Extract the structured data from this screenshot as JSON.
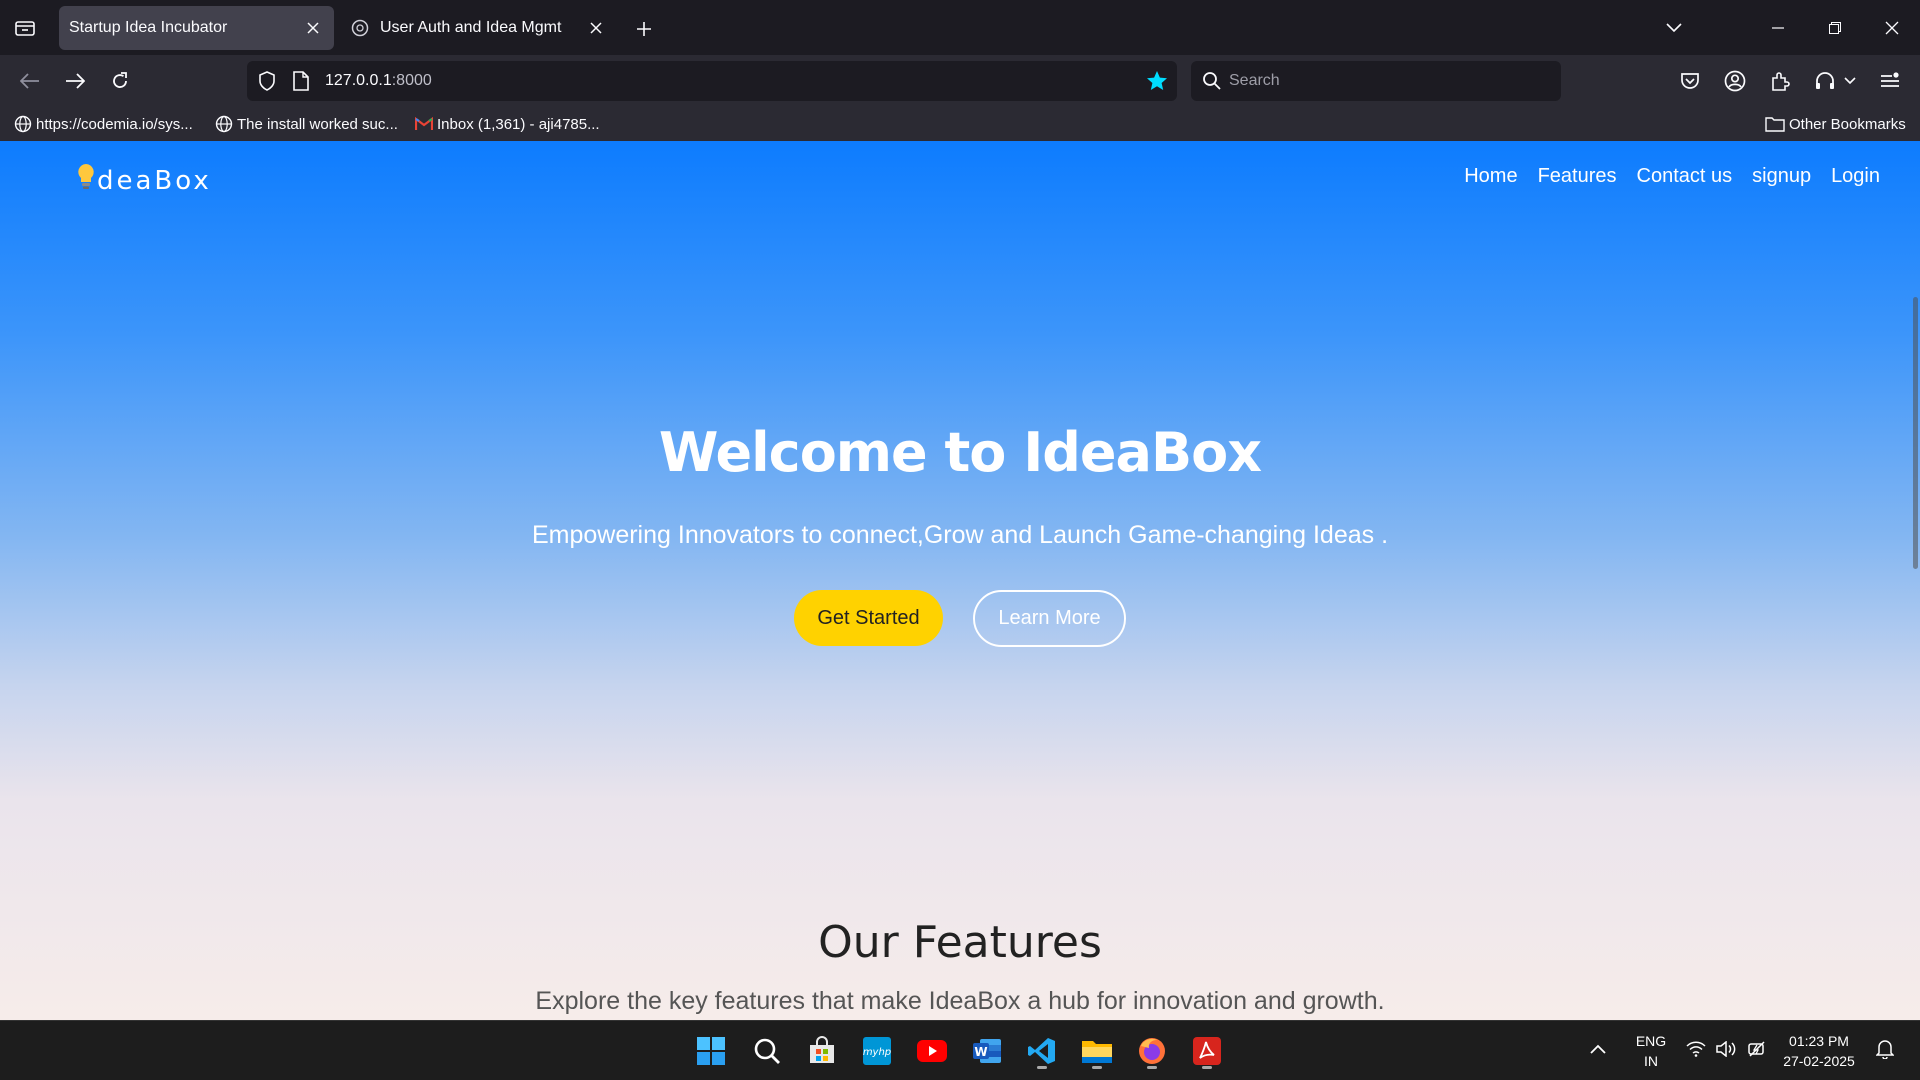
{
  "browser": {
    "tabs": [
      {
        "title": "Startup Idea Incubator",
        "active": true
      },
      {
        "title": "User Auth and Idea Mgmt",
        "active": false
      }
    ],
    "url": {
      "host": "127.0.0.1",
      "port": ":8000"
    },
    "search_placeholder": "Search",
    "bookmarks": [
      {
        "label": "https://codemia.io/sys...",
        "icon": "globe-icon"
      },
      {
        "label": "The install worked suc...",
        "icon": "globe-icon"
      },
      {
        "label": "Inbox (1,361) - aji4785...",
        "icon": "gmail-icon"
      }
    ],
    "other_bookmarks": "Other Bookmarks",
    "accent": "#00ddff"
  },
  "site": {
    "brand_rest": "deaBox",
    "nav": [
      "Home",
      "Features",
      "Contact us",
      "signup",
      "Login"
    ],
    "hero": {
      "title": "Welcome to IdeaBox",
      "subtitle": "Empowering Innovators to connect,Grow and Launch Game-changing Ideas .",
      "primary_button": "Get Started",
      "secondary_button": "Learn More"
    },
    "features": {
      "title": "Our Features",
      "subtitle": "Explore the key features that make IdeaBox a hub for innovation and growth."
    },
    "colors": {
      "primary": "#0d7cfe",
      "button_yellow": "#ffd200"
    }
  },
  "taskbar": {
    "apps": [
      "windows-start-icon",
      "search-icon",
      "store-icon",
      "myhp-icon",
      "youtube-icon",
      "word-icon",
      "vscode-icon",
      "file-explorer-icon",
      "firefox-icon",
      "acrobat-icon"
    ],
    "lang_1": "ENG",
    "lang_2": "IN",
    "time": "01:23 PM",
    "date": "27-02-2025"
  }
}
